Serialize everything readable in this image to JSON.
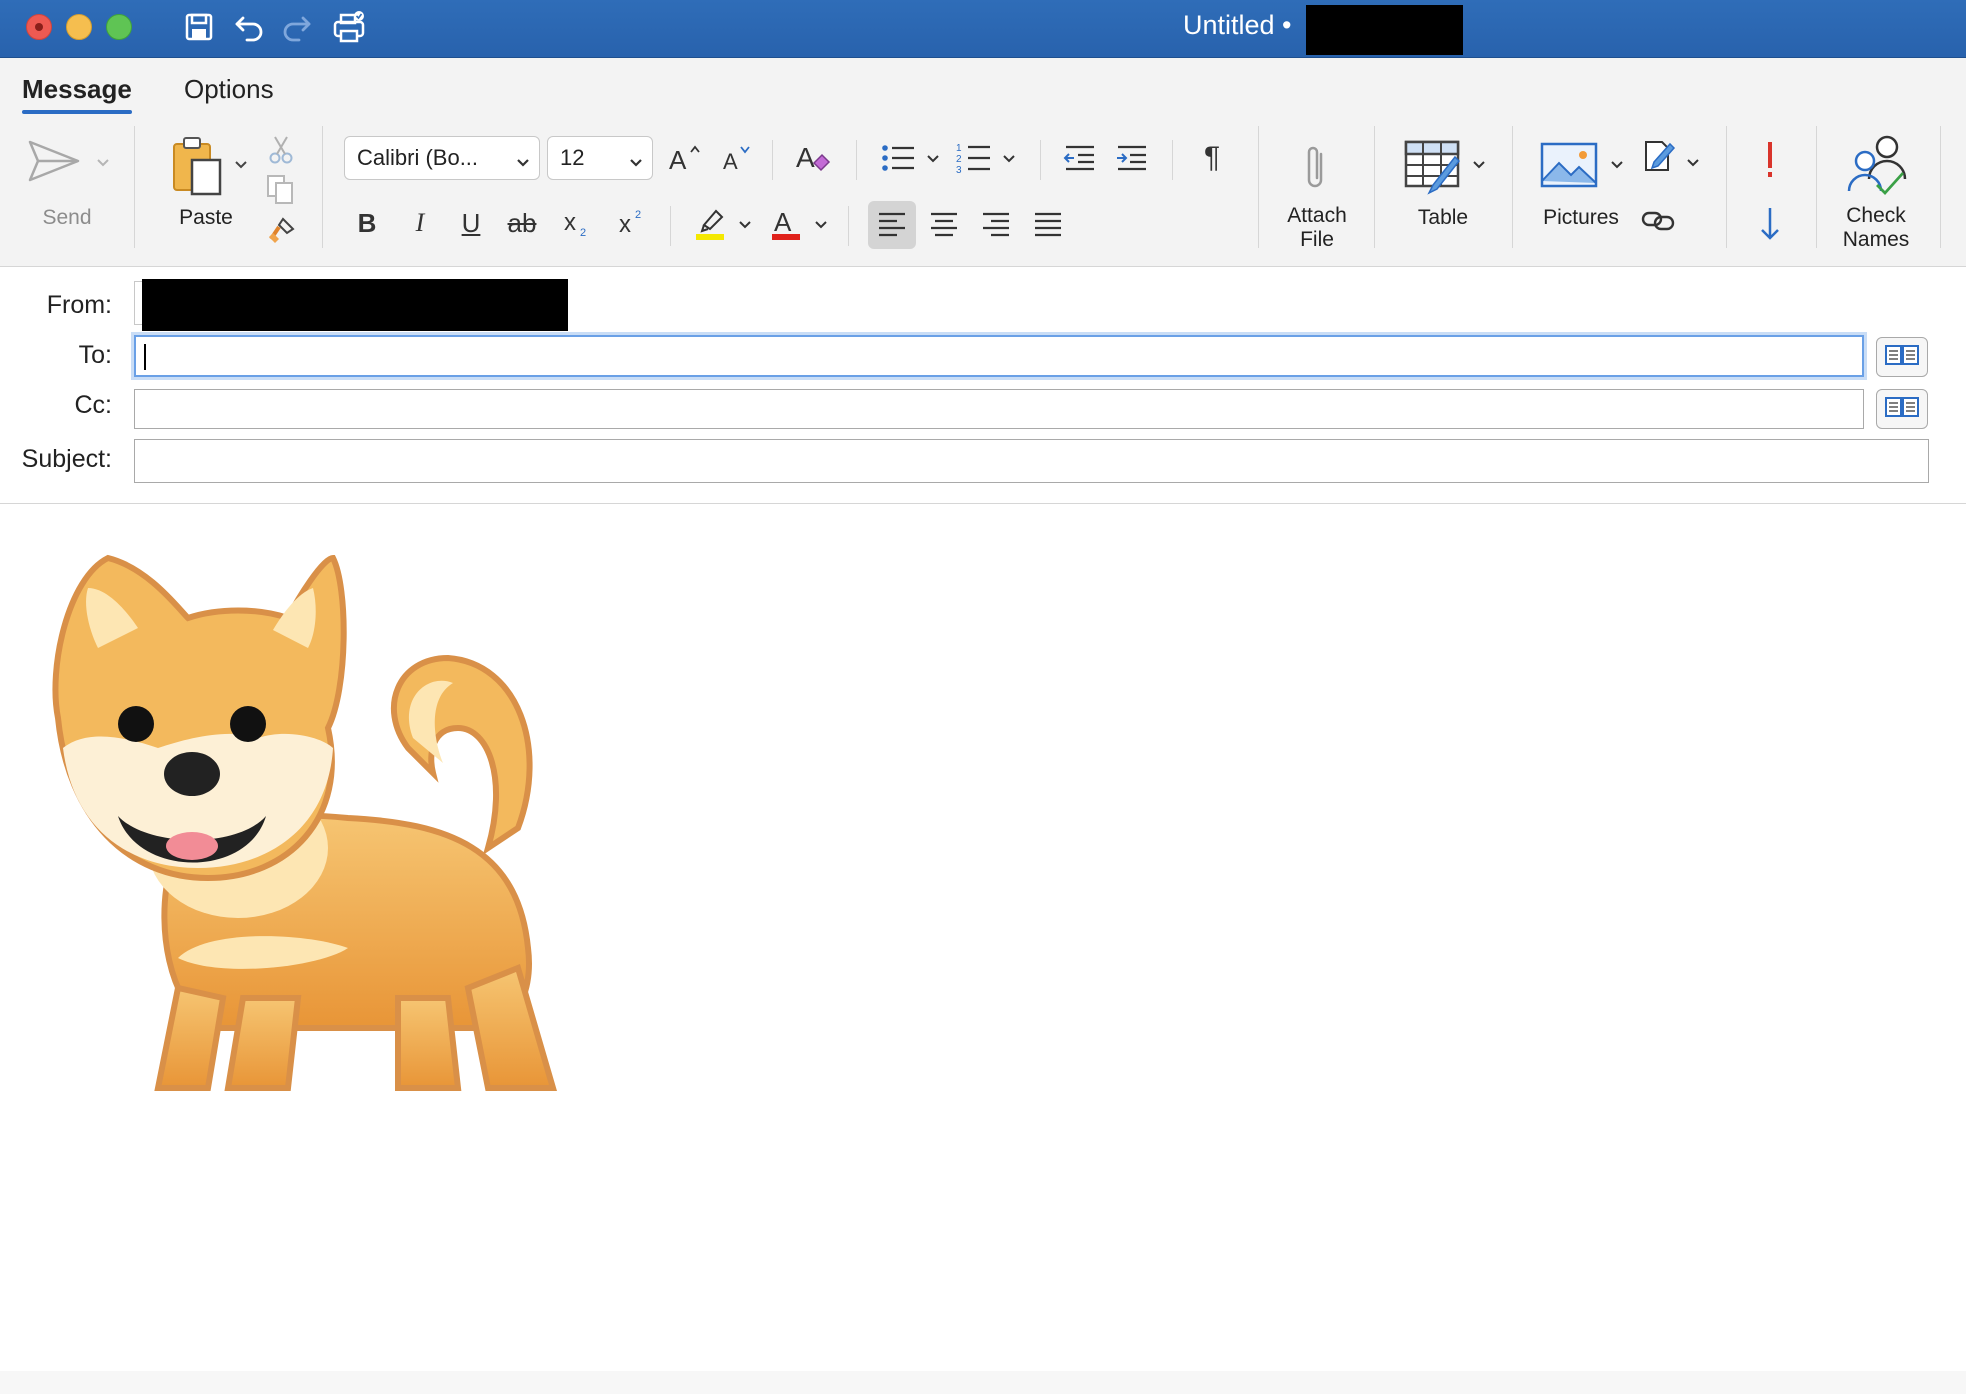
{
  "window": {
    "title": "Untitled •"
  },
  "tabs": [
    "Message",
    "Options"
  ],
  "ribbon": {
    "send": "Send",
    "paste": "Paste",
    "font_name": "Calibri (Bo...",
    "font_size": "12",
    "attach_file": [
      "Attach",
      "File"
    ],
    "table": "Table",
    "pictures": "Pictures",
    "check_names": [
      "Check",
      "Names"
    ],
    "highlight_color": "#f4e800",
    "font_color": "#e0211b",
    "accent": "#2b6cc4",
    "importance_high_color": "#d9342b"
  },
  "header": {
    "from_label": "From:",
    "to_label": "To:",
    "cc_label": "Cc:",
    "subject_label": "Subject:",
    "to_value": "",
    "cc_value": "",
    "subject_value": ""
  },
  "body": {
    "image": "shiba-dog-emoji"
  }
}
